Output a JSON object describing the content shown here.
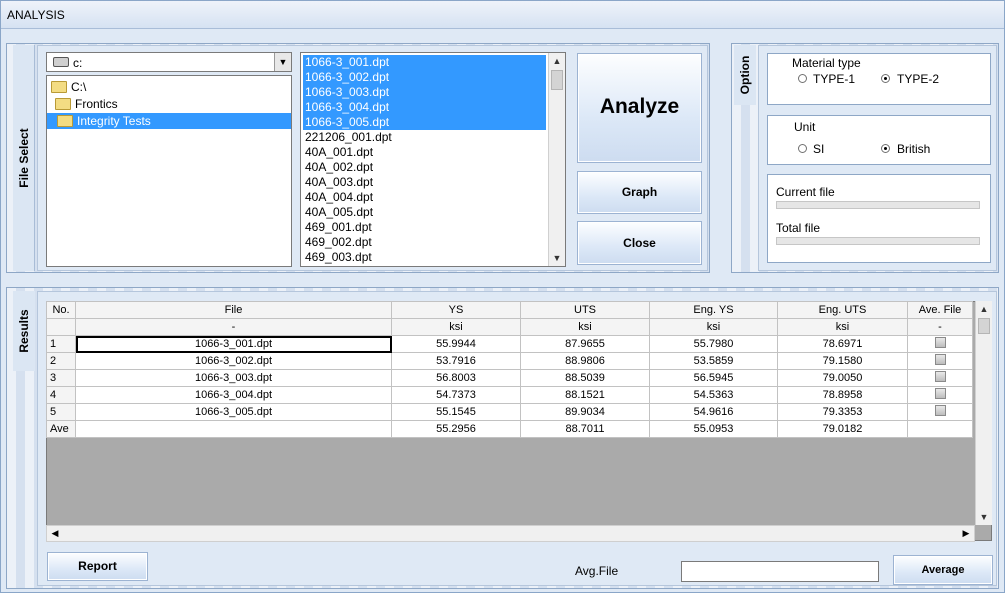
{
  "window": {
    "title": "ANALYSIS"
  },
  "file_select": {
    "section_label": "File Select",
    "drive": "c:",
    "directories": [
      {
        "label": "C:\\",
        "selected": false
      },
      {
        "label": "Frontics",
        "selected": false
      },
      {
        "label": "Integrity Tests",
        "selected": true
      }
    ],
    "files": [
      {
        "name": "1066-3_001.dpt",
        "selected": true
      },
      {
        "name": "1066-3_002.dpt",
        "selected": true
      },
      {
        "name": "1066-3_003.dpt",
        "selected": true
      },
      {
        "name": "1066-3_004.dpt",
        "selected": true
      },
      {
        "name": "1066-3_005.dpt",
        "selected": true
      },
      {
        "name": "221206_001.dpt",
        "selected": false
      },
      {
        "name": "40A_001.dpt",
        "selected": false
      },
      {
        "name": "40A_002.dpt",
        "selected": false
      },
      {
        "name": "40A_003.dpt",
        "selected": false
      },
      {
        "name": "40A_004.dpt",
        "selected": false
      },
      {
        "name": "40A_005.dpt",
        "selected": false
      },
      {
        "name": "469_001.dpt",
        "selected": false
      },
      {
        "name": "469_002.dpt",
        "selected": false
      },
      {
        "name": "469_003.dpt",
        "selected": false
      }
    ]
  },
  "buttons": {
    "analyze": "Analyze",
    "graph": "Graph",
    "close": "Close",
    "report": "Report",
    "average": "Average"
  },
  "option": {
    "section_label": "Option",
    "material_type": {
      "caption": "Material type",
      "options": [
        "TYPE-1",
        "TYPE-2"
      ],
      "selected": "TYPE-2"
    },
    "unit": {
      "caption": "Unit",
      "options": [
        "SI",
        "British"
      ],
      "selected": "British"
    },
    "current_file_label": "Current file",
    "total_file_label": "Total file"
  },
  "results": {
    "section_label": "Results",
    "columns": [
      "No.",
      "File",
      "YS",
      "UTS",
      "Eng. YS",
      "Eng. UTS",
      "Ave. File"
    ],
    "units": [
      "",
      "-",
      "ksi",
      "ksi",
      "ksi",
      "ksi",
      "-"
    ],
    "rows": [
      {
        "no": "1",
        "file": "1066-3_001.dpt",
        "ys": "55.9944",
        "uts": "87.9655",
        "eng_ys": "55.7980",
        "eng_uts": "78.6971"
      },
      {
        "no": "2",
        "file": "1066-3_002.dpt",
        "ys": "53.7916",
        "uts": "88.9806",
        "eng_ys": "53.5859",
        "eng_uts": "79.1580"
      },
      {
        "no": "3",
        "file": "1066-3_003.dpt",
        "ys": "56.8003",
        "uts": "88.5039",
        "eng_ys": "56.5945",
        "eng_uts": "79.0050"
      },
      {
        "no": "4",
        "file": "1066-3_004.dpt",
        "ys": "54.7373",
        "uts": "88.1521",
        "eng_ys": "54.5363",
        "eng_uts": "78.8958"
      },
      {
        "no": "5",
        "file": "1066-3_005.dpt",
        "ys": "55.1545",
        "uts": "89.9034",
        "eng_ys": "54.9616",
        "eng_uts": "79.3353"
      }
    ],
    "average": {
      "no": "Ave",
      "file": "",
      "ys": "55.2956",
      "uts": "88.7011",
      "eng_ys": "55.0953",
      "eng_uts": "79.0182"
    }
  },
  "footer": {
    "avg_file_label": "Avg.File",
    "avg_file_value": ""
  }
}
